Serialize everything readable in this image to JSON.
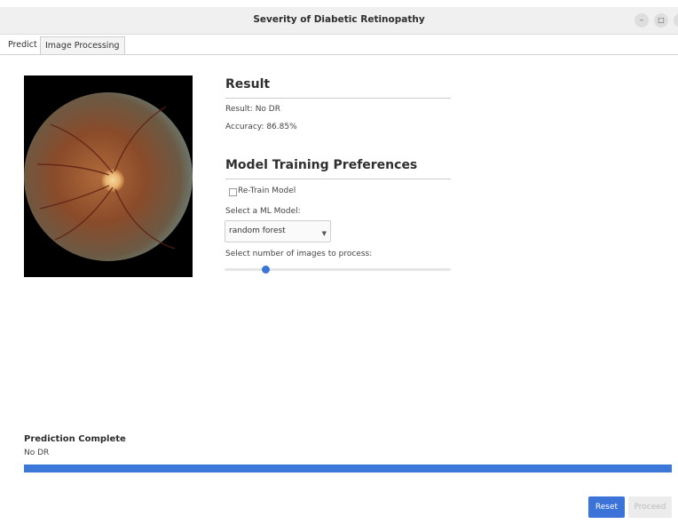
{
  "window": {
    "title": "Severity of Diabetic Retinopathy",
    "controls": {
      "minimize": "–",
      "maximize": "□",
      "close": "×"
    }
  },
  "tabs": [
    {
      "label": "Predict",
      "active": true
    },
    {
      "label": "Image Processing",
      "active": false
    }
  ],
  "result": {
    "heading": "Result",
    "result_text": "Result: No DR",
    "accuracy_text": "Accuracy: 86.85%"
  },
  "preferences": {
    "heading": "Model Training Preferences",
    "retrain_label": "Re-Train Model",
    "retrain_checked": false,
    "model_label": "Select a ML Model:",
    "model_value": "random forest",
    "images_label": "Select number of images to process:",
    "images_slider_fraction": 0.18
  },
  "status": {
    "title": "Prediction Complete",
    "text": "No DR",
    "progress_percent": 100,
    "accent_color": "#3c78d8"
  },
  "buttons": {
    "reset": "Reset",
    "proceed": "Proceed"
  }
}
